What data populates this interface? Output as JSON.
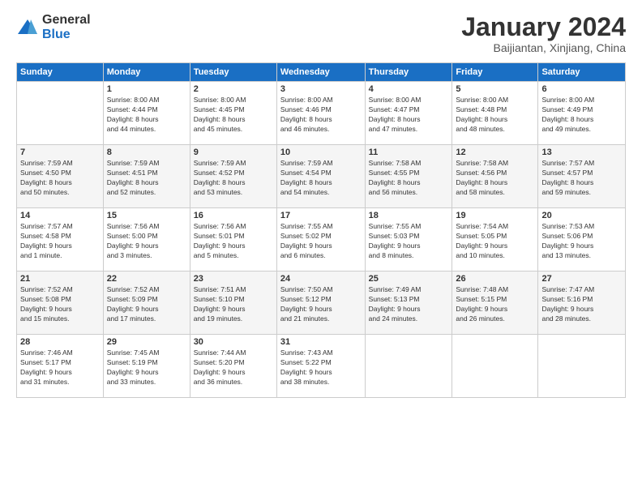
{
  "logo": {
    "line1": "General",
    "line2": "Blue"
  },
  "header": {
    "title": "January 2024",
    "subtitle": "Baijiantan, Xinjiang, China"
  },
  "days_of_week": [
    "Sunday",
    "Monday",
    "Tuesday",
    "Wednesday",
    "Thursday",
    "Friday",
    "Saturday"
  ],
  "weeks": [
    [
      {
        "day": "",
        "info": ""
      },
      {
        "day": "1",
        "info": "Sunrise: 8:00 AM\nSunset: 4:44 PM\nDaylight: 8 hours\nand 44 minutes."
      },
      {
        "day": "2",
        "info": "Sunrise: 8:00 AM\nSunset: 4:45 PM\nDaylight: 8 hours\nand 45 minutes."
      },
      {
        "day": "3",
        "info": "Sunrise: 8:00 AM\nSunset: 4:46 PM\nDaylight: 8 hours\nand 46 minutes."
      },
      {
        "day": "4",
        "info": "Sunrise: 8:00 AM\nSunset: 4:47 PM\nDaylight: 8 hours\nand 47 minutes."
      },
      {
        "day": "5",
        "info": "Sunrise: 8:00 AM\nSunset: 4:48 PM\nDaylight: 8 hours\nand 48 minutes."
      },
      {
        "day": "6",
        "info": "Sunrise: 8:00 AM\nSunset: 4:49 PM\nDaylight: 8 hours\nand 49 minutes."
      }
    ],
    [
      {
        "day": "7",
        "info": "Sunrise: 7:59 AM\nSunset: 4:50 PM\nDaylight: 8 hours\nand 50 minutes."
      },
      {
        "day": "8",
        "info": "Sunrise: 7:59 AM\nSunset: 4:51 PM\nDaylight: 8 hours\nand 52 minutes."
      },
      {
        "day": "9",
        "info": "Sunrise: 7:59 AM\nSunset: 4:52 PM\nDaylight: 8 hours\nand 53 minutes."
      },
      {
        "day": "10",
        "info": "Sunrise: 7:59 AM\nSunset: 4:54 PM\nDaylight: 8 hours\nand 54 minutes."
      },
      {
        "day": "11",
        "info": "Sunrise: 7:58 AM\nSunset: 4:55 PM\nDaylight: 8 hours\nand 56 minutes."
      },
      {
        "day": "12",
        "info": "Sunrise: 7:58 AM\nSunset: 4:56 PM\nDaylight: 8 hours\nand 58 minutes."
      },
      {
        "day": "13",
        "info": "Sunrise: 7:57 AM\nSunset: 4:57 PM\nDaylight: 8 hours\nand 59 minutes."
      }
    ],
    [
      {
        "day": "14",
        "info": "Sunrise: 7:57 AM\nSunset: 4:58 PM\nDaylight: 9 hours\nand 1 minute."
      },
      {
        "day": "15",
        "info": "Sunrise: 7:56 AM\nSunset: 5:00 PM\nDaylight: 9 hours\nand 3 minutes."
      },
      {
        "day": "16",
        "info": "Sunrise: 7:56 AM\nSunset: 5:01 PM\nDaylight: 9 hours\nand 5 minutes."
      },
      {
        "day": "17",
        "info": "Sunrise: 7:55 AM\nSunset: 5:02 PM\nDaylight: 9 hours\nand 6 minutes."
      },
      {
        "day": "18",
        "info": "Sunrise: 7:55 AM\nSunset: 5:03 PM\nDaylight: 9 hours\nand 8 minutes."
      },
      {
        "day": "19",
        "info": "Sunrise: 7:54 AM\nSunset: 5:05 PM\nDaylight: 9 hours\nand 10 minutes."
      },
      {
        "day": "20",
        "info": "Sunrise: 7:53 AM\nSunset: 5:06 PM\nDaylight: 9 hours\nand 13 minutes."
      }
    ],
    [
      {
        "day": "21",
        "info": "Sunrise: 7:52 AM\nSunset: 5:08 PM\nDaylight: 9 hours\nand 15 minutes."
      },
      {
        "day": "22",
        "info": "Sunrise: 7:52 AM\nSunset: 5:09 PM\nDaylight: 9 hours\nand 17 minutes."
      },
      {
        "day": "23",
        "info": "Sunrise: 7:51 AM\nSunset: 5:10 PM\nDaylight: 9 hours\nand 19 minutes."
      },
      {
        "day": "24",
        "info": "Sunrise: 7:50 AM\nSunset: 5:12 PM\nDaylight: 9 hours\nand 21 minutes."
      },
      {
        "day": "25",
        "info": "Sunrise: 7:49 AM\nSunset: 5:13 PM\nDaylight: 9 hours\nand 24 minutes."
      },
      {
        "day": "26",
        "info": "Sunrise: 7:48 AM\nSunset: 5:15 PM\nDaylight: 9 hours\nand 26 minutes."
      },
      {
        "day": "27",
        "info": "Sunrise: 7:47 AM\nSunset: 5:16 PM\nDaylight: 9 hours\nand 28 minutes."
      }
    ],
    [
      {
        "day": "28",
        "info": "Sunrise: 7:46 AM\nSunset: 5:17 PM\nDaylight: 9 hours\nand 31 minutes."
      },
      {
        "day": "29",
        "info": "Sunrise: 7:45 AM\nSunset: 5:19 PM\nDaylight: 9 hours\nand 33 minutes."
      },
      {
        "day": "30",
        "info": "Sunrise: 7:44 AM\nSunset: 5:20 PM\nDaylight: 9 hours\nand 36 minutes."
      },
      {
        "day": "31",
        "info": "Sunrise: 7:43 AM\nSunset: 5:22 PM\nDaylight: 9 hours\nand 38 minutes."
      },
      {
        "day": "",
        "info": ""
      },
      {
        "day": "",
        "info": ""
      },
      {
        "day": "",
        "info": ""
      }
    ]
  ]
}
